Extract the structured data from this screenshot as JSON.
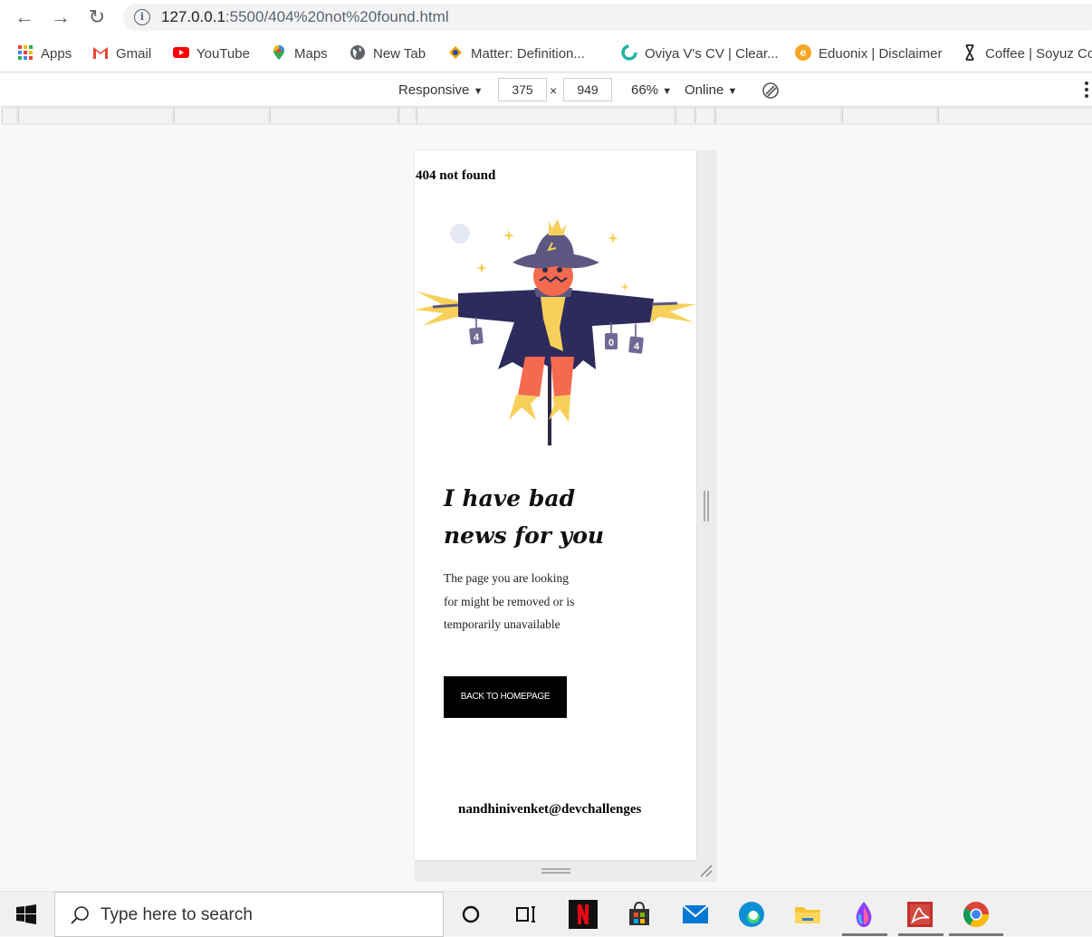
{
  "browser": {
    "url_host": "127.0.0.1",
    "url_rest": ":5500/404%20not%20found.html"
  },
  "bookmarks": [
    {
      "label": "Apps",
      "icon": "apps-grid-icon"
    },
    {
      "label": "Gmail",
      "icon": "gmail-icon"
    },
    {
      "label": "YouTube",
      "icon": "youtube-icon"
    },
    {
      "label": "Maps",
      "icon": "maps-icon"
    },
    {
      "label": "New Tab",
      "icon": "globe-icon"
    },
    {
      "label": "Matter: Definition...",
      "icon": "matter-icon"
    },
    {
      "label": "Oviya V's CV | Clear...",
      "icon": "clear-icon"
    },
    {
      "label": "Eduonix | Disclaimer",
      "icon": "eduonix-icon"
    },
    {
      "label": "Coffee | Soyuz Co",
      "icon": "coffee-icon"
    }
  ],
  "devtools": {
    "device": "Responsive",
    "width": "375",
    "times": "×",
    "height": "949",
    "zoom": "66%",
    "network": "Online"
  },
  "page": {
    "heading": "404 not found",
    "headline_line1": "I have bad",
    "headline_line2": "news for you",
    "body_lines": [
      "The page you are looking",
      "for might be removed or is",
      "temporarily unavailable"
    ],
    "button_label": "BACK TO HOMEPAGE",
    "credit": "nandhinivenket@devchallenges",
    "sign_left": "4",
    "sign_right_1": "0",
    "sign_right_2": "4"
  },
  "taskbar": {
    "search_placeholder": "Type here to search",
    "apps": [
      "cortana-icon",
      "task-view-icon",
      "netflix-icon",
      "store-icon",
      "mail-icon",
      "edge-icon",
      "file-explorer-icon",
      "paint-icon",
      "acrobat-icon",
      "chrome-icon"
    ]
  }
}
